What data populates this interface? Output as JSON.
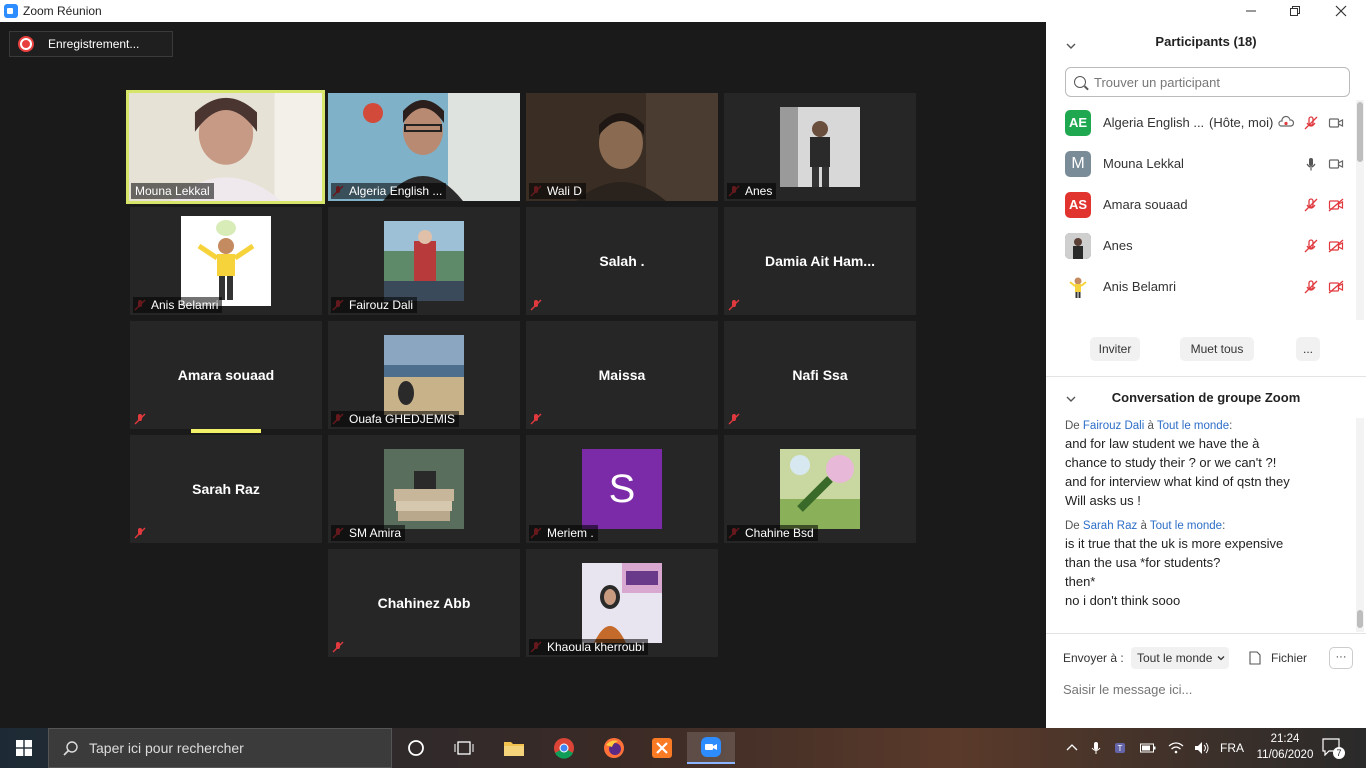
{
  "window": {
    "title": "Zoom Réunion"
  },
  "recording": {
    "label": "Enregistrement..."
  },
  "tiles": [
    {
      "name": "Mouna Lekkal",
      "muted": false
    },
    {
      "name": "Algeria English ...",
      "muted": true
    },
    {
      "name": "Wali D",
      "muted": true
    },
    {
      "name": "Anes",
      "muted": true
    },
    {
      "name": "Anis Belamri",
      "muted": true
    },
    {
      "name": "Fairouz Dali",
      "muted": true
    },
    {
      "name": "Salah .",
      "muted": true
    },
    {
      "name": "Damia Ait Ham...",
      "muted": true
    },
    {
      "name": "Amara souaad",
      "muted": true
    },
    {
      "name": "Ouafa GHEDJEMIS",
      "muted": true
    },
    {
      "name": "Maissa",
      "muted": true
    },
    {
      "name": "Nafi Ssa",
      "muted": true
    },
    {
      "name": "Sarah Raz",
      "muted": true
    },
    {
      "name": "SM Amira",
      "muted": true
    },
    {
      "name": "Meriem .",
      "muted": true,
      "initial": "S"
    },
    {
      "name": "Chahine Bsd",
      "muted": true
    },
    {
      "name": "Chahinez Abb",
      "muted": true
    },
    {
      "name": "Khaoula kherroubi",
      "muted": true
    }
  ],
  "participants_panel": {
    "header": "Participants (18)",
    "search_placeholder": "Trouver un participant",
    "list": [
      {
        "initials": "AE",
        "color": "#1fa84f",
        "name": "Algeria English ...",
        "tag": "(Hôte, moi)"
      },
      {
        "initials": "M",
        "color": "#7b8c99",
        "name": "Mouna Lekkal",
        "tag": ""
      },
      {
        "initials": "AS",
        "color": "#e2342f",
        "name": "Amara souaad",
        "tag": ""
      },
      {
        "initials": "",
        "color": "#555555",
        "name": "Anes",
        "tag": ""
      },
      {
        "initials": "",
        "color": "#f6d33a",
        "name": "Anis Belamri",
        "tag": ""
      }
    ],
    "buttons": {
      "invite": "Inviter",
      "mute_all": "Muet tous",
      "more": "..."
    }
  },
  "chat": {
    "title": "Conversation de groupe Zoom",
    "messages": [
      {
        "prefix": "De ",
        "sender": "Fairouz Dali",
        "to_word": " à ",
        "recipient": "Tout le monde",
        "suffix": ":",
        "lines": [
          "and for law student we have the à",
          "chance to study their ?  or we can't ?!",
          "and for interview what kind of qstn they",
          "Will asks us !"
        ]
      },
      {
        "prefix": "De ",
        "sender": "Sarah Raz",
        "to_word": " à ",
        "recipient": "Tout le monde",
        "suffix": ":",
        "lines": [
          "is it true that the uk is more expensive",
          "than the usa  *for students?",
          "then*",
          "no i don't think sooo"
        ]
      }
    ],
    "send_to_label": "Envoyer à :",
    "send_to_value": "Tout le monde",
    "file_label": "Fichier",
    "more_label": "···",
    "input_placeholder": "Saisir le message ici..."
  },
  "taskbar": {
    "search_placeholder": "Taper ici pour rechercher",
    "language": "FRA",
    "time": "21:24",
    "date": "11/06/2020",
    "notifications": "7"
  },
  "colors": {
    "active_speaker": "#d7e56a",
    "link": "#2d6ec7",
    "zoom_blue": "#2d8cff"
  }
}
